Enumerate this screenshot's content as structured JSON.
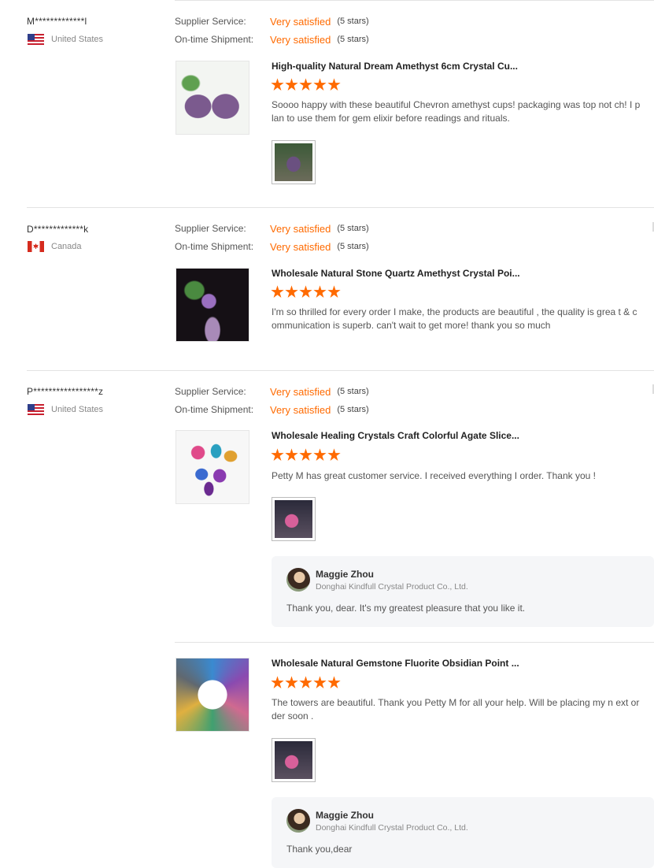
{
  "labels": {
    "supplier_service": "Supplier Service:",
    "ontime_shipment": "On-time Shipment:"
  },
  "reviews": [
    {
      "buyer": "M*************l",
      "country": "United States",
      "flag": "us-flag-icon",
      "supplier_rating": "Very satisfied",
      "supplier_stars": "(5 stars)",
      "shipment_rating": "Very satisfied",
      "shipment_stars": "(5 stars)",
      "product_title": "High-quality Natural Dream Amethyst 6cm Crystal Cu...",
      "rating": 5,
      "text": "Soooo happy with these beautiful Chevron amethyst cups! packaging was top not ch! I plan to use them for gem elixir before readings and rituals."
    },
    {
      "buyer": "D*************k",
      "country": "Canada",
      "flag": "canada-flag-icon",
      "supplier_rating": "Very satisfied",
      "supplier_stars": "(5 stars)",
      "shipment_rating": "Very satisfied",
      "shipment_stars": "(5 stars)",
      "product_title": "Wholesale Natural Stone Quartz Amethyst Crystal Poi...",
      "rating": 5,
      "text": "I'm so thrilled for every order I make, the products are beautiful , the quality is grea t & communication is superb. can't wait to get more! thank you so much"
    },
    {
      "buyer": "P*****************z",
      "country": "United States",
      "flag": "us-flag-icon",
      "supplier_rating": "Very satisfied",
      "supplier_stars": "(5 stars)",
      "shipment_rating": "Very satisfied",
      "shipment_stars": "(5 stars)",
      "product_title": "Wholesale Healing Crystals Craft Colorful Agate Slice...",
      "rating": 5,
      "text": "Petty M has great customer service. I received everything I order. Thank you !",
      "reply": {
        "name": "Maggie Zhou",
        "company": "Donghai Kindfull Crystal Product Co., Ltd.",
        "text": "Thank you, dear. It's my greatest pleasure that you like it."
      },
      "sub_review": {
        "product_title": "Wholesale Natural Gemstone Fluorite Obsidian Point ...",
        "rating": 5,
        "text": "The towers are beautiful. Thank  you Petty M for all your help. Will be placing my n ext order soon .",
        "reply": {
          "name": "Maggie Zhou",
          "company": "Donghai Kindfull Crystal Product Co., Ltd.",
          "text": "Thank you,dear"
        }
      }
    }
  ],
  "colors": {
    "accent": "#ff6a00",
    "divider": "#e3e3e3",
    "reply_bg": "#f5f6f8"
  }
}
